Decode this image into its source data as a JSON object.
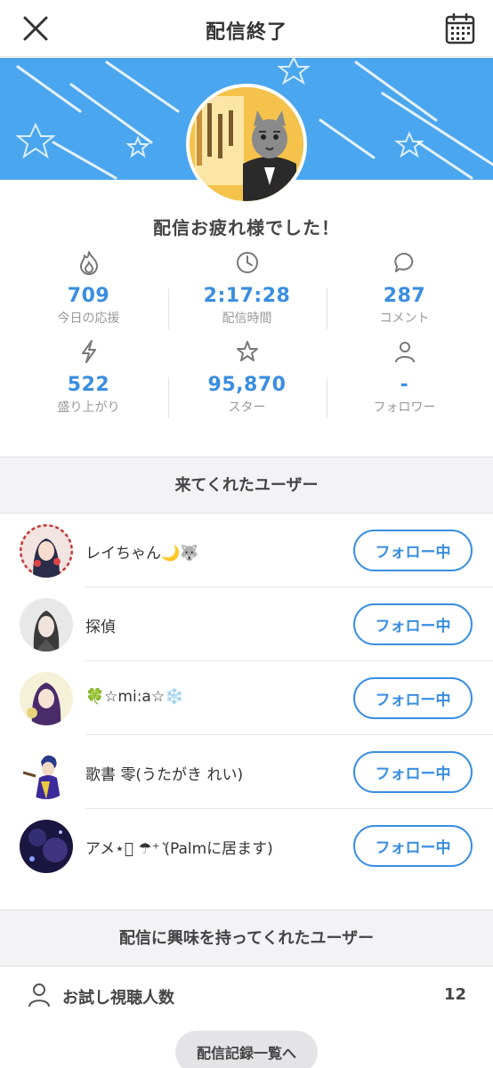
{
  "header": {
    "title": "配信終了",
    "close_icon": "close-icon",
    "calendar_icon": "calendar-icon"
  },
  "banner": {
    "background_color": "#4aa6ee"
  },
  "thanks": "配信お疲れ様でした！",
  "stats": [
    {
      "icon": "flame-icon",
      "value": "709",
      "label": "今日の応援"
    },
    {
      "icon": "clock-icon",
      "value": "2:17:28",
      "label": "配信時間"
    },
    {
      "icon": "comment-icon",
      "value": "287",
      "label": "コメント"
    },
    {
      "icon": "lightning-icon",
      "value": "522",
      "label": "盛り上がり"
    },
    {
      "icon": "star-icon",
      "value": "95,870",
      "label": "スター"
    },
    {
      "icon": "person-icon",
      "value": "-",
      "label": "フォロワー"
    }
  ],
  "visited_users": {
    "title": "来てくれたユーザー",
    "users": [
      {
        "name": "レイちゃん🌙🐺",
        "button": "フォロー中"
      },
      {
        "name": "探偵",
        "button": "フォロー中"
      },
      {
        "name": "🍀☆mi:a☆❄️",
        "button": "フォロー中"
      },
      {
        "name": "歌書 零(うたがき れい)",
        "button": "フォロー中"
      },
      {
        "name": "アメ⋆͛ ☂︎⁺  ͛(Palmに居ます)",
        "button": "フォロー中"
      }
    ]
  },
  "interested_users": {
    "title": "配信に興味を持ってくれたユーザー",
    "trial_viewers_label": "お試し視聴人数",
    "trial_viewers_value": "12"
  },
  "bottom_button": "配信記録一覧へ",
  "colors": {
    "accent": "#3a8ee0",
    "banner": "#4aa6ee"
  }
}
